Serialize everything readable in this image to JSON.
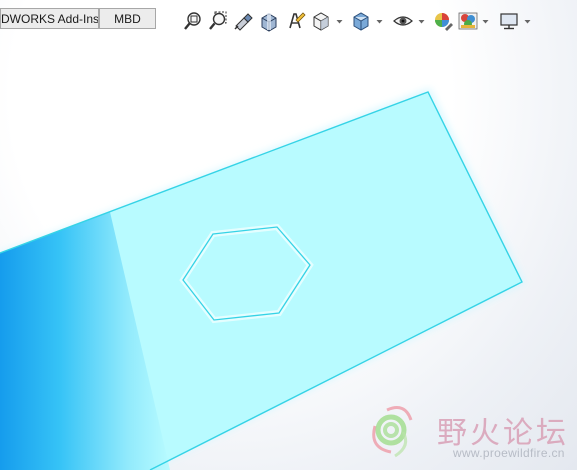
{
  "tabs": [
    {
      "label": "DWORKS Add-Ins"
    },
    {
      "label": "MBD"
    }
  ],
  "heads_up_toolbar": {
    "buttons": [
      {
        "icon": "zoom-to-fit-icon"
      },
      {
        "icon": "zoom-to-area-icon"
      },
      {
        "icon": "previous-view-icon"
      },
      {
        "icon": "section-view-icon"
      },
      {
        "icon": "dynamic-annotation-views-icon"
      },
      {
        "icon": "view-orientation-icon"
      },
      {
        "icon": "display-style-icon"
      },
      {
        "icon": "hide-show-items-icon"
      },
      {
        "icon": "edit-appearance-icon"
      },
      {
        "icon": "apply-scene-icon"
      },
      {
        "icon": "view-settings-icon"
      }
    ]
  },
  "model": {
    "part_color": "#b8fbff",
    "edge_color": "#35d3e6",
    "shade_color": "#1aa8f2"
  },
  "watermark": {
    "text": "野火论坛",
    "url": "www.proewildfire.cn"
  }
}
